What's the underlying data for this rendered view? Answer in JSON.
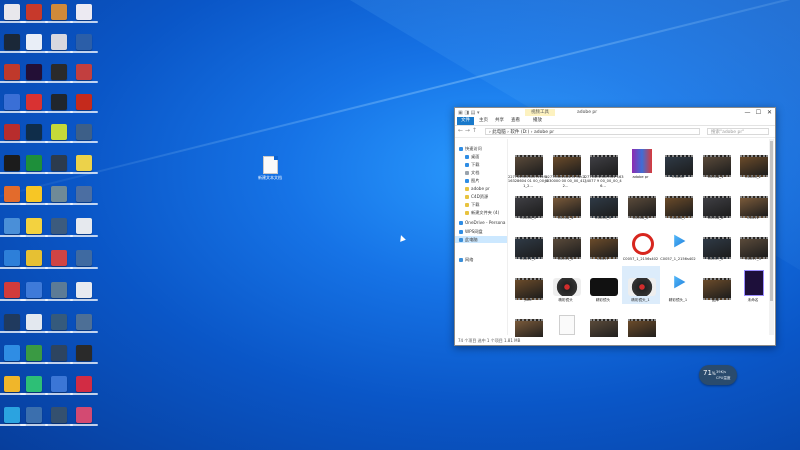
{
  "desktop_icon_colors": [
    [
      "#e8e8ec",
      "#c7392b",
      "#d08a3a",
      "#eceaf2"
    ],
    [
      "#1b2838",
      "#e9eef7",
      "#d7d7df",
      "#2b5ea8"
    ],
    [
      "#c0392b",
      "#230f36",
      "#2a2a2a",
      "#c23f3f"
    ],
    [
      "#3a6fd6",
      "#d93232",
      "#20262d",
      "#c52a1c"
    ],
    [
      "#b82d2d",
      "#0f2d4a",
      "#c5d93a",
      "#3d5f88"
    ],
    [
      "#1c1c1c",
      "#1e8f3a",
      "#2c3b4d",
      "#ecd24a"
    ],
    [
      "#e36b2c",
      "#f7c625",
      "#6f8a97",
      "#4b6ea2"
    ],
    [
      "#4a8fd8",
      "#f3d23f",
      "#3c5b7e",
      "#e6e9ee"
    ],
    [
      "#2d7fd9",
      "#e6c033",
      "#cf4444",
      "#3f6aa1"
    ],
    [
      "#d23b3b",
      "#3e7ad9",
      "#5c7b96",
      "#e7eaf0"
    ],
    [
      "#203a5e",
      "#e3e8ef",
      "#355a7c",
      "#4d6f96"
    ],
    [
      "#2f8de4",
      "#3a9a43",
      "#2d4460",
      "#2a2a2a"
    ],
    [
      "#f0b62a",
      "#2dbf76",
      "#3b76d6",
      "#d22c44"
    ],
    [
      "#2ba3e0",
      "#3b6fae",
      "#34506f",
      "#d34a72"
    ]
  ],
  "file_icon": {
    "label": "新建文本文档"
  },
  "explorer": {
    "title_tools": "▣ ◨ ▤ ▾",
    "context_tab": "视频工具",
    "window_title": "adobe pr",
    "window_buttons": [
      "—",
      "☐",
      "✕"
    ],
    "ribbon_tabs": [
      "文件",
      "主页",
      "共享",
      "查看",
      "播放"
    ],
    "nav_arrows": "← → ↑",
    "address": "› 此电脑 › 软件 (D:) › adobe pr",
    "search_placeholder": "搜索\"adobe pr\"",
    "nav_items": [
      {
        "label": "快速访问",
        "icon": "star-icon",
        "color": "#2f8de4"
      },
      {
        "label": "桌面",
        "icon": "desktop-icon",
        "color": "#2f8de4"
      },
      {
        "label": "下载",
        "icon": "download-icon",
        "color": "#2f8de4"
      },
      {
        "label": "文档",
        "icon": "document-icon",
        "color": "#9aa3ad"
      },
      {
        "label": "图片",
        "icon": "pictures-icon",
        "color": "#2f8de4"
      },
      {
        "label": "adobe pr",
        "icon": "folder-icon",
        "color": "#e8c33f"
      },
      {
        "label": "C4D资源",
        "icon": "folder-icon",
        "color": "#e8c33f"
      },
      {
        "label": "下载",
        "icon": "folder-icon",
        "color": "#e8c33f"
      },
      {
        "label": "新建文件夹 (4)",
        "icon": "folder-icon",
        "color": "#e8c33f"
      },
      {
        "label": "OneDrive - Persona",
        "icon": "cloud-icon",
        "color": "#2f8de4"
      },
      {
        "label": "WPS网盘",
        "icon": "cloud-icon",
        "color": "#2f8de4"
      },
      {
        "label": "此电脑",
        "icon": "computer-icon",
        "color": "#3b8fd9"
      },
      {
        "label": "网络",
        "icon": "network-icon",
        "color": "#3b8fd9"
      }
    ],
    "files": [
      {
        "label": "2277049e04005cec9c 16328604 01 00_00_41_2...",
        "kind": "video"
      },
      {
        "label": "227704e4ba4f0c9dc 16330000 00 00_00_41_2...",
        "kind": "video"
      },
      {
        "label": "227704c4fa0f0f04 16334077 9 00_00_00_46...",
        "kind": "video"
      },
      {
        "label": "adobe pr",
        "kind": "rar"
      },
      {
        "label": "C0008",
        "kind": "video"
      },
      {
        "label": "C0008_1",
        "kind": "video"
      },
      {
        "label": "C0008_2",
        "kind": "video"
      },
      {
        "label": "C0008_3",
        "kind": "video"
      },
      {
        "label": "C0008_4",
        "kind": "video"
      },
      {
        "label": "C0008_5",
        "kind": "video"
      },
      {
        "label": "C0008_6",
        "kind": "video"
      },
      {
        "label": "C0008_7",
        "kind": "video"
      },
      {
        "label": "C0008_8",
        "kind": "video"
      },
      {
        "label": "C0051",
        "kind": "video"
      },
      {
        "label": "C0051_1",
        "kind": "video"
      },
      {
        "label": "C0051_2",
        "kind": "video"
      },
      {
        "label": "C0057",
        "kind": "video"
      },
      {
        "label": "C0057_1_2156s402",
        "kind": "netease"
      },
      {
        "label": "C0057_1_2156s402",
        "kind": "player"
      },
      {
        "label": "C0057_2",
        "kind": "video"
      },
      {
        "label": "C0057_3",
        "kind": "video"
      },
      {
        "label": "Jttle",
        "kind": "video"
      },
      {
        "label": "精彩镜头",
        "kind": "vinyl"
      },
      {
        "label": "精彩镜头",
        "kind": "vinyl-dark"
      },
      {
        "label": "精彩镜头_1",
        "kind": "vinyl-sel"
      },
      {
        "label": "精彩镜头_1",
        "kind": "player"
      },
      {
        "label": "图库",
        "kind": "video"
      },
      {
        "label": "未命名",
        "kind": "premiere"
      },
      {
        "label": "视频素材",
        "kind": "video"
      },
      {
        "label": "新建文本文档",
        "kind": "textdoc"
      },
      {
        "label": "动态素材",
        "kind": "video"
      },
      {
        "label": "专业视频",
        "kind": "video"
      }
    ],
    "status": "74 个项目    选中 1 个项目  1.81 MB"
  },
  "netmon": {
    "value": "71",
    "unit": "%",
    "line1": "39K/s",
    "line2": "CPU温度"
  }
}
